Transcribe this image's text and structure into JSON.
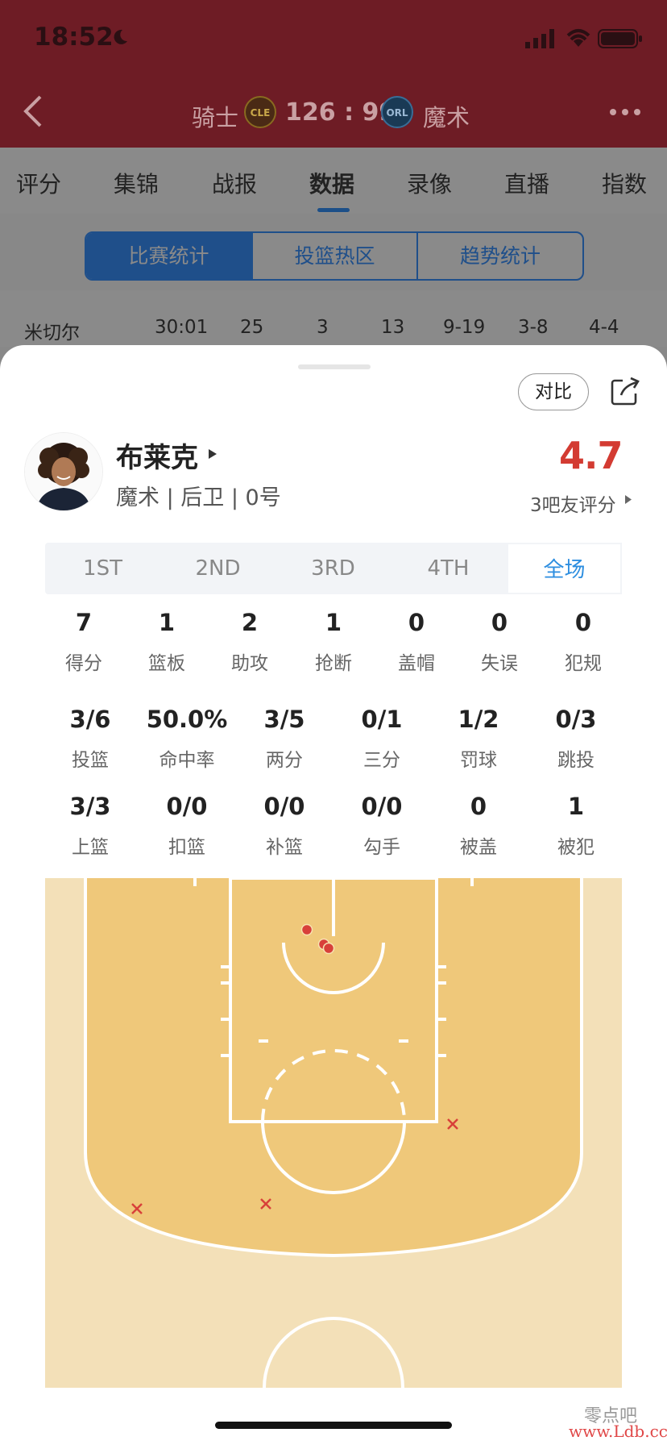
{
  "status": {
    "time": "18:52"
  },
  "header": {
    "home_team": "骑士",
    "home_logo_text": "CLE",
    "score": "126 : 99",
    "away_logo_text": "ORL",
    "away_team": "魔术"
  },
  "tabs": [
    "评分",
    "集锦",
    "战报",
    "数据",
    "录像",
    "直播",
    "指数"
  ],
  "active_tab": "数据",
  "segments": [
    "比赛统计",
    "投篮热区",
    "趋势统计"
  ],
  "background_row": [
    "米切尔",
    "30:01",
    "25",
    "3",
    "13",
    "9-19",
    "3-8",
    "4-4"
  ],
  "sheet": {
    "compare_label": "对比",
    "player": {
      "name": "布莱克",
      "info": "魔术 | 后卫 | 0号",
      "rating": "4.7",
      "rating_label": "3吧友评分"
    },
    "periods": [
      "1ST",
      "2ND",
      "3RD",
      "4TH",
      "全场"
    ],
    "active_period": "全场",
    "stats_row1": [
      {
        "value": "7",
        "label": "得分"
      },
      {
        "value": "1",
        "label": "篮板"
      },
      {
        "value": "2",
        "label": "助攻"
      },
      {
        "value": "1",
        "label": "抢断"
      },
      {
        "value": "0",
        "label": "盖帽"
      },
      {
        "value": "0",
        "label": "失误"
      },
      {
        "value": "0",
        "label": "犯规"
      }
    ],
    "stats_row2": [
      {
        "value": "3/6",
        "label": "投篮"
      },
      {
        "value": "50.0%",
        "label": "命中率"
      },
      {
        "value": "3/5",
        "label": "两分"
      },
      {
        "value": "0/1",
        "label": "三分"
      },
      {
        "value": "1/2",
        "label": "罚球"
      },
      {
        "value": "0/3",
        "label": "跳投"
      }
    ],
    "stats_row3": [
      {
        "value": "3/3",
        "label": "上篮"
      },
      {
        "value": "0/0",
        "label": "扣篮"
      },
      {
        "value": "0/0",
        "label": "补篮"
      },
      {
        "value": "0/0",
        "label": "勾手"
      },
      {
        "value": "0",
        "label": "被盖"
      },
      {
        "value": "1",
        "label": "被犯"
      }
    ],
    "shot_chart": {
      "made_count": 3,
      "missed_count": 3
    }
  },
  "watermark": {
    "cn": "零点吧",
    "url": "www.Ldb.cc"
  },
  "colors": {
    "rating": "#d33b32",
    "active_period": "#2d8ee0",
    "made_shot": "#d8403a",
    "missed_shot": "#d8403a",
    "court_paint": "#efc87a",
    "court_outer": "#f3e0b8"
  }
}
